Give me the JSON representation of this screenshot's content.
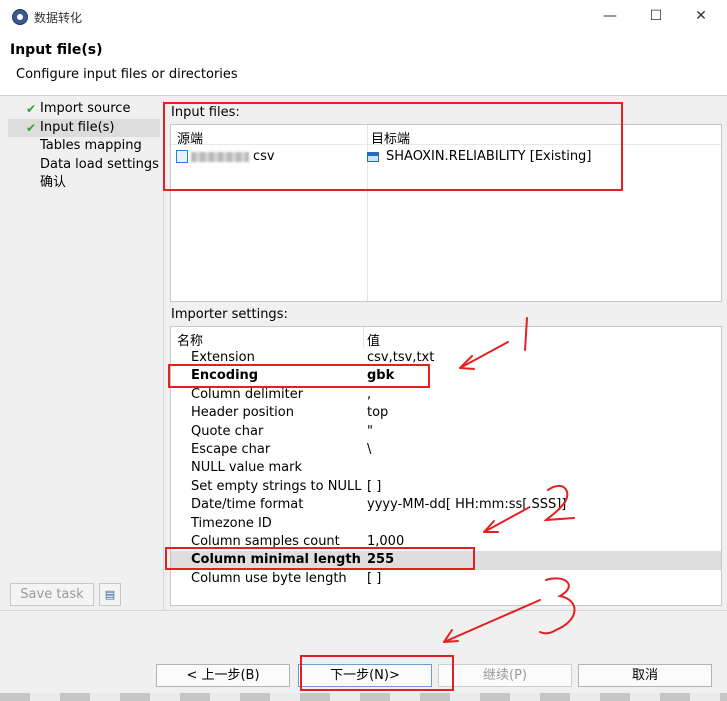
{
  "window": {
    "title": "数据转化",
    "minimize": "—",
    "maximize": "☐",
    "close": "✕"
  },
  "header": {
    "title": "Input file(s)",
    "subtitle": "Configure input files or directories"
  },
  "nav": {
    "items": [
      {
        "label": "Import source",
        "done": true
      },
      {
        "label": "Input file(s)",
        "done": true,
        "active": true
      },
      {
        "label": "Tables mapping",
        "done": false
      },
      {
        "label": "Data load settings",
        "done": false
      },
      {
        "label": "确认",
        "done": false
      }
    ],
    "save_task": "Save task"
  },
  "input_files": {
    "section_label": "Input files:",
    "columns": [
      "源端",
      "目标端"
    ],
    "rows": [
      {
        "source_ext": "csv",
        "target": "SHAOXIN.RELIABILITY [Existing]"
      }
    ]
  },
  "importer": {
    "section_label": "Importer settings:",
    "columns": [
      "名称",
      "值"
    ],
    "rows": [
      {
        "name": "Extension",
        "value": "csv,tsv,txt"
      },
      {
        "name": "Encoding",
        "value": "gbk"
      },
      {
        "name": "Column delimiter",
        "value": ","
      },
      {
        "name": "Header position",
        "value": "top"
      },
      {
        "name": "Quote char",
        "value": "\""
      },
      {
        "name": "Escape char",
        "value": "\\"
      },
      {
        "name": "NULL value mark",
        "value": ""
      },
      {
        "name": "Set empty strings to NULL",
        "value": "[ ]"
      },
      {
        "name": "Date/time format",
        "value": "yyyy-MM-dd[ HH:mm:ss[.SSS]]"
      },
      {
        "name": "Timezone ID",
        "value": ""
      },
      {
        "name": "Column samples count",
        "value": "1,000"
      },
      {
        "name": "Column minimal length",
        "value": "255"
      },
      {
        "name": "Column use byte length",
        "value": "[ ]"
      }
    ]
  },
  "footer": {
    "back": "< 上一步(B)",
    "next": "下一步(N)>",
    "continue": "继续(P)",
    "cancel": "取消"
  },
  "annotations": {
    "color": "#e52020",
    "marks": [
      "1",
      "2",
      "3"
    ]
  }
}
